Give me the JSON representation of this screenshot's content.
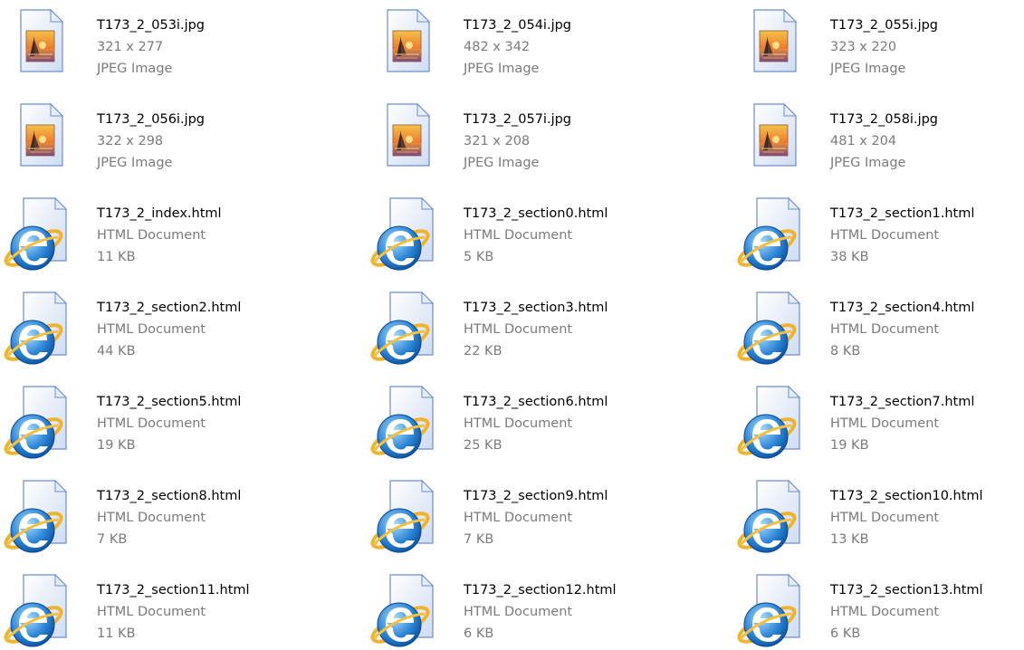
{
  "files": [
    {
      "name": "T173_2_053i.jpg",
      "line2": "321 x 277",
      "line3": "JPEG Image",
      "icon": "jpeg-image-icon"
    },
    {
      "name": "T173_2_054i.jpg",
      "line2": "482 x 342",
      "line3": "JPEG Image",
      "icon": "jpeg-image-icon"
    },
    {
      "name": "T173_2_055i.jpg",
      "line2": "323 x 220",
      "line3": "JPEG Image",
      "icon": "jpeg-image-icon"
    },
    {
      "name": "T173_2_056i.jpg",
      "line2": "322 x 298",
      "line3": "JPEG Image",
      "icon": "jpeg-image-icon"
    },
    {
      "name": "T173_2_057i.jpg",
      "line2": "321 x 208",
      "line3": "JPEG Image",
      "icon": "jpeg-image-icon"
    },
    {
      "name": "T173_2_058i.jpg",
      "line2": "481 x 204",
      "line3": "JPEG Image",
      "icon": "jpeg-image-icon"
    },
    {
      "name": "T173_2_index.html",
      "line2": "HTML Document",
      "line3": "11 KB",
      "icon": "internet-explorer-html-icon"
    },
    {
      "name": "T173_2_section0.html",
      "line2": "HTML Document",
      "line3": "5 KB",
      "icon": "internet-explorer-html-icon"
    },
    {
      "name": "T173_2_section1.html",
      "line2": "HTML Document",
      "line3": "38 KB",
      "icon": "internet-explorer-html-icon"
    },
    {
      "name": "T173_2_section2.html",
      "line2": "HTML Document",
      "line3": "44 KB",
      "icon": "internet-explorer-html-icon"
    },
    {
      "name": "T173_2_section3.html",
      "line2": "HTML Document",
      "line3": "22 KB",
      "icon": "internet-explorer-html-icon"
    },
    {
      "name": "T173_2_section4.html",
      "line2": "HTML Document",
      "line3": "8 KB",
      "icon": "internet-explorer-html-icon"
    },
    {
      "name": "T173_2_section5.html",
      "line2": "HTML Document",
      "line3": "19 KB",
      "icon": "internet-explorer-html-icon"
    },
    {
      "name": "T173_2_section6.html",
      "line2": "HTML Document",
      "line3": "25 KB",
      "icon": "internet-explorer-html-icon"
    },
    {
      "name": "T173_2_section7.html",
      "line2": "HTML Document",
      "line3": "19 KB",
      "icon": "internet-explorer-html-icon"
    },
    {
      "name": "T173_2_section8.html",
      "line2": "HTML Document",
      "line3": "7 KB",
      "icon": "internet-explorer-html-icon"
    },
    {
      "name": "T173_2_section9.html",
      "line2": "HTML Document",
      "line3": "7 KB",
      "icon": "internet-explorer-html-icon"
    },
    {
      "name": "T173_2_section10.html",
      "line2": "HTML Document",
      "line3": "13 KB",
      "icon": "internet-explorer-html-icon"
    },
    {
      "name": "T173_2_section11.html",
      "line2": "HTML Document",
      "line3": "11 KB",
      "icon": "internet-explorer-html-icon"
    },
    {
      "name": "T173_2_section12.html",
      "line2": "HTML Document",
      "line3": "6 KB",
      "icon": "internet-explorer-html-icon"
    },
    {
      "name": "T173_2_section13.html",
      "line2": "HTML Document",
      "line3": "6 KB",
      "icon": "internet-explorer-html-icon"
    }
  ]
}
